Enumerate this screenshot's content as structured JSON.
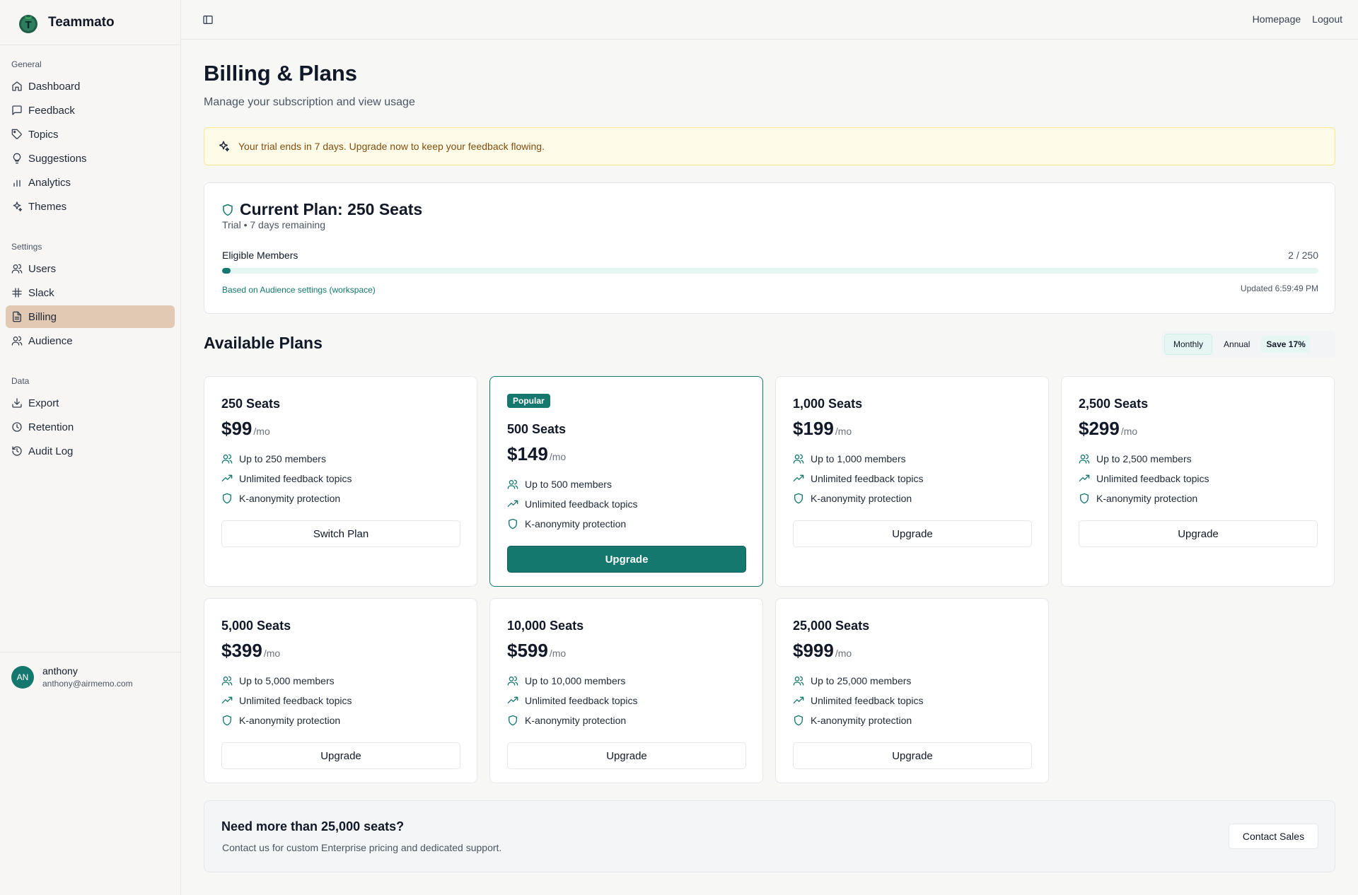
{
  "app": {
    "name": "Teammato"
  },
  "sidebar": {
    "groups": [
      {
        "label": "General",
        "items": [
          {
            "label": "Dashboard",
            "icon": "home-icon"
          },
          {
            "label": "Feedback",
            "icon": "message-square-icon"
          },
          {
            "label": "Topics",
            "icon": "tag-icon"
          },
          {
            "label": "Suggestions",
            "icon": "lightbulb-icon"
          },
          {
            "label": "Analytics",
            "icon": "bar-chart-icon"
          },
          {
            "label": "Themes",
            "icon": "sparkles-icon"
          }
        ]
      },
      {
        "label": "Settings",
        "items": [
          {
            "label": "Users",
            "icon": "users-icon"
          },
          {
            "label": "Slack",
            "icon": "slack-icon"
          },
          {
            "label": "Billing",
            "icon": "file-text-icon",
            "active": true
          },
          {
            "label": "Audience",
            "icon": "users-icon"
          }
        ]
      },
      {
        "label": "Data",
        "items": [
          {
            "label": "Export",
            "icon": "download-icon"
          },
          {
            "label": "Retention",
            "icon": "clock-icon"
          },
          {
            "label": "Audit Log",
            "icon": "history-icon"
          }
        ]
      }
    ],
    "user": {
      "initials": "AN",
      "name": "anthony",
      "email": "anthony@airmemo.com"
    }
  },
  "topbar": {
    "links": [
      "Homepage",
      "Logout"
    ]
  },
  "page": {
    "title": "Billing & Plans",
    "subtitle": "Manage your subscription and view usage"
  },
  "trial_banner": {
    "text": "Your trial ends in 7 days. Upgrade now to keep your feedback flowing."
  },
  "current_plan": {
    "title": "Current Plan: 250 Seats",
    "subtitle": "Trial • 7 days remaining",
    "members_label": "Eligible Members",
    "members_count": "2 / 250",
    "members_fraction": 0.008,
    "note": "Based on Audience settings (workspace)",
    "updated": "Updated 6:59:49 PM"
  },
  "available_plans": {
    "title": "Available Plans",
    "toggle": {
      "monthly": "Monthly",
      "annual": "Annual",
      "save": "Save 17%",
      "selected": "Monthly"
    },
    "per_label": "/mo",
    "popular_badge": "Popular",
    "plans": [
      {
        "name": "250 Seats",
        "price": "$99",
        "features": [
          "Up to 250 members",
          "Unlimited feedback topics",
          "K-anonymity protection"
        ],
        "button": "Switch Plan"
      },
      {
        "name": "500 Seats",
        "price": "$149",
        "popular": true,
        "features": [
          "Up to 500 members",
          "Unlimited feedback topics",
          "K-anonymity protection"
        ],
        "button": "Upgrade"
      },
      {
        "name": "1,000 Seats",
        "price": "$199",
        "features": [
          "Up to 1,000 members",
          "Unlimited feedback topics",
          "K-anonymity protection"
        ],
        "button": "Upgrade"
      },
      {
        "name": "2,500 Seats",
        "price": "$299",
        "features": [
          "Up to 2,500 members",
          "Unlimited feedback topics",
          "K-anonymity protection"
        ],
        "button": "Upgrade"
      },
      {
        "name": "5,000 Seats",
        "price": "$399",
        "features": [
          "Up to 5,000 members",
          "Unlimited feedback topics",
          "K-anonymity protection"
        ],
        "button": "Upgrade"
      },
      {
        "name": "10,000 Seats",
        "price": "$599",
        "features": [
          "Up to 10,000 members",
          "Unlimited feedback topics",
          "K-anonymity protection"
        ],
        "button": "Upgrade"
      },
      {
        "name": "25,000 Seats",
        "price": "$999",
        "features": [
          "Up to 25,000 members",
          "Unlimited feedback topics",
          "K-anonymity protection"
        ],
        "button": "Upgrade"
      }
    ]
  },
  "enterprise": {
    "title": "Need more than 25,000 seats?",
    "subtitle": "Contact us for custom Enterprise pricing and dedicated support.",
    "button": "Contact Sales"
  },
  "colors": {
    "accent": "#14786e",
    "active_nav": "#e2c9b4",
    "banner_bg": "#fefce8",
    "banner_text": "#854d0e"
  }
}
